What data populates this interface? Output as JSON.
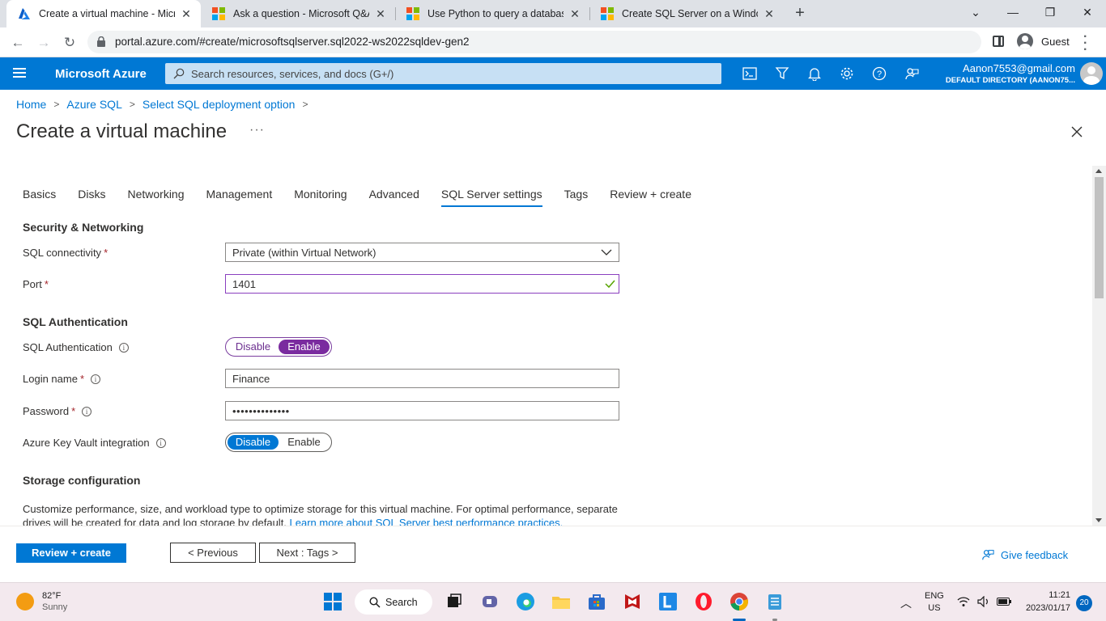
{
  "browser": {
    "tabs": [
      {
        "title": "Create a virtual machine - Micros",
        "active": true
      },
      {
        "title": "Ask a question - Microsoft Q&A",
        "active": false
      },
      {
        "title": "Use Python to query a database",
        "active": false
      },
      {
        "title": "Create SQL Server on a Windows",
        "active": false
      }
    ],
    "url": "portal.azure.com/#create/microsoftsqlserver.sql2022-ws2022sqldev-gen2",
    "profile": "Guest"
  },
  "azure": {
    "brand": "Microsoft Azure",
    "search_placeholder": "Search resources, services, and docs (G+/)",
    "account_email": "Aanon7553@gmail.com",
    "account_directory": "DEFAULT DIRECTORY (AANON75..."
  },
  "breadcrumb": [
    "Home",
    "Azure SQL",
    "Select SQL deployment option"
  ],
  "page_title": "Create a virtual machine",
  "wizard_tabs": [
    "Basics",
    "Disks",
    "Networking",
    "Management",
    "Monitoring",
    "Advanced",
    "SQL Server settings",
    "Tags",
    "Review + create"
  ],
  "selected_tab": "SQL Server settings",
  "security": {
    "heading": "Security & Networking",
    "connectivity_label": "SQL connectivity",
    "connectivity_value": "Private (within Virtual Network)",
    "port_label": "Port",
    "port_value": "1401"
  },
  "auth": {
    "heading": "SQL Authentication",
    "auth_label": "SQL Authentication",
    "auth_disable": "Disable",
    "auth_enable": "Enable",
    "login_label": "Login name",
    "login_value": "Finance",
    "password_label": "Password",
    "password_value": "••••••••••••••",
    "akv_label": "Azure Key Vault integration",
    "akv_disable": "Disable",
    "akv_enable": "Enable"
  },
  "storage": {
    "heading": "Storage configuration",
    "text": "Customize performance, size, and workload type to optimize storage for this virtual machine. For optimal performance, separate drives will be created for data and log storage by default. ",
    "link": "Learn more about SQL Server best performance practices."
  },
  "footer": {
    "review_create": "Review + create",
    "previous": "< Previous",
    "next": "Next : Tags >",
    "feedback": "Give feedback"
  },
  "taskbar": {
    "temp": "82°F",
    "weather": "Sunny",
    "search": "Search",
    "lang1": "ENG",
    "lang2": "US",
    "time": "11:21",
    "date": "2023/01/17",
    "badge": "20"
  },
  "colors": {
    "azure_blue": "#0078d4",
    "purple_toggle": "#7a2b9f"
  }
}
